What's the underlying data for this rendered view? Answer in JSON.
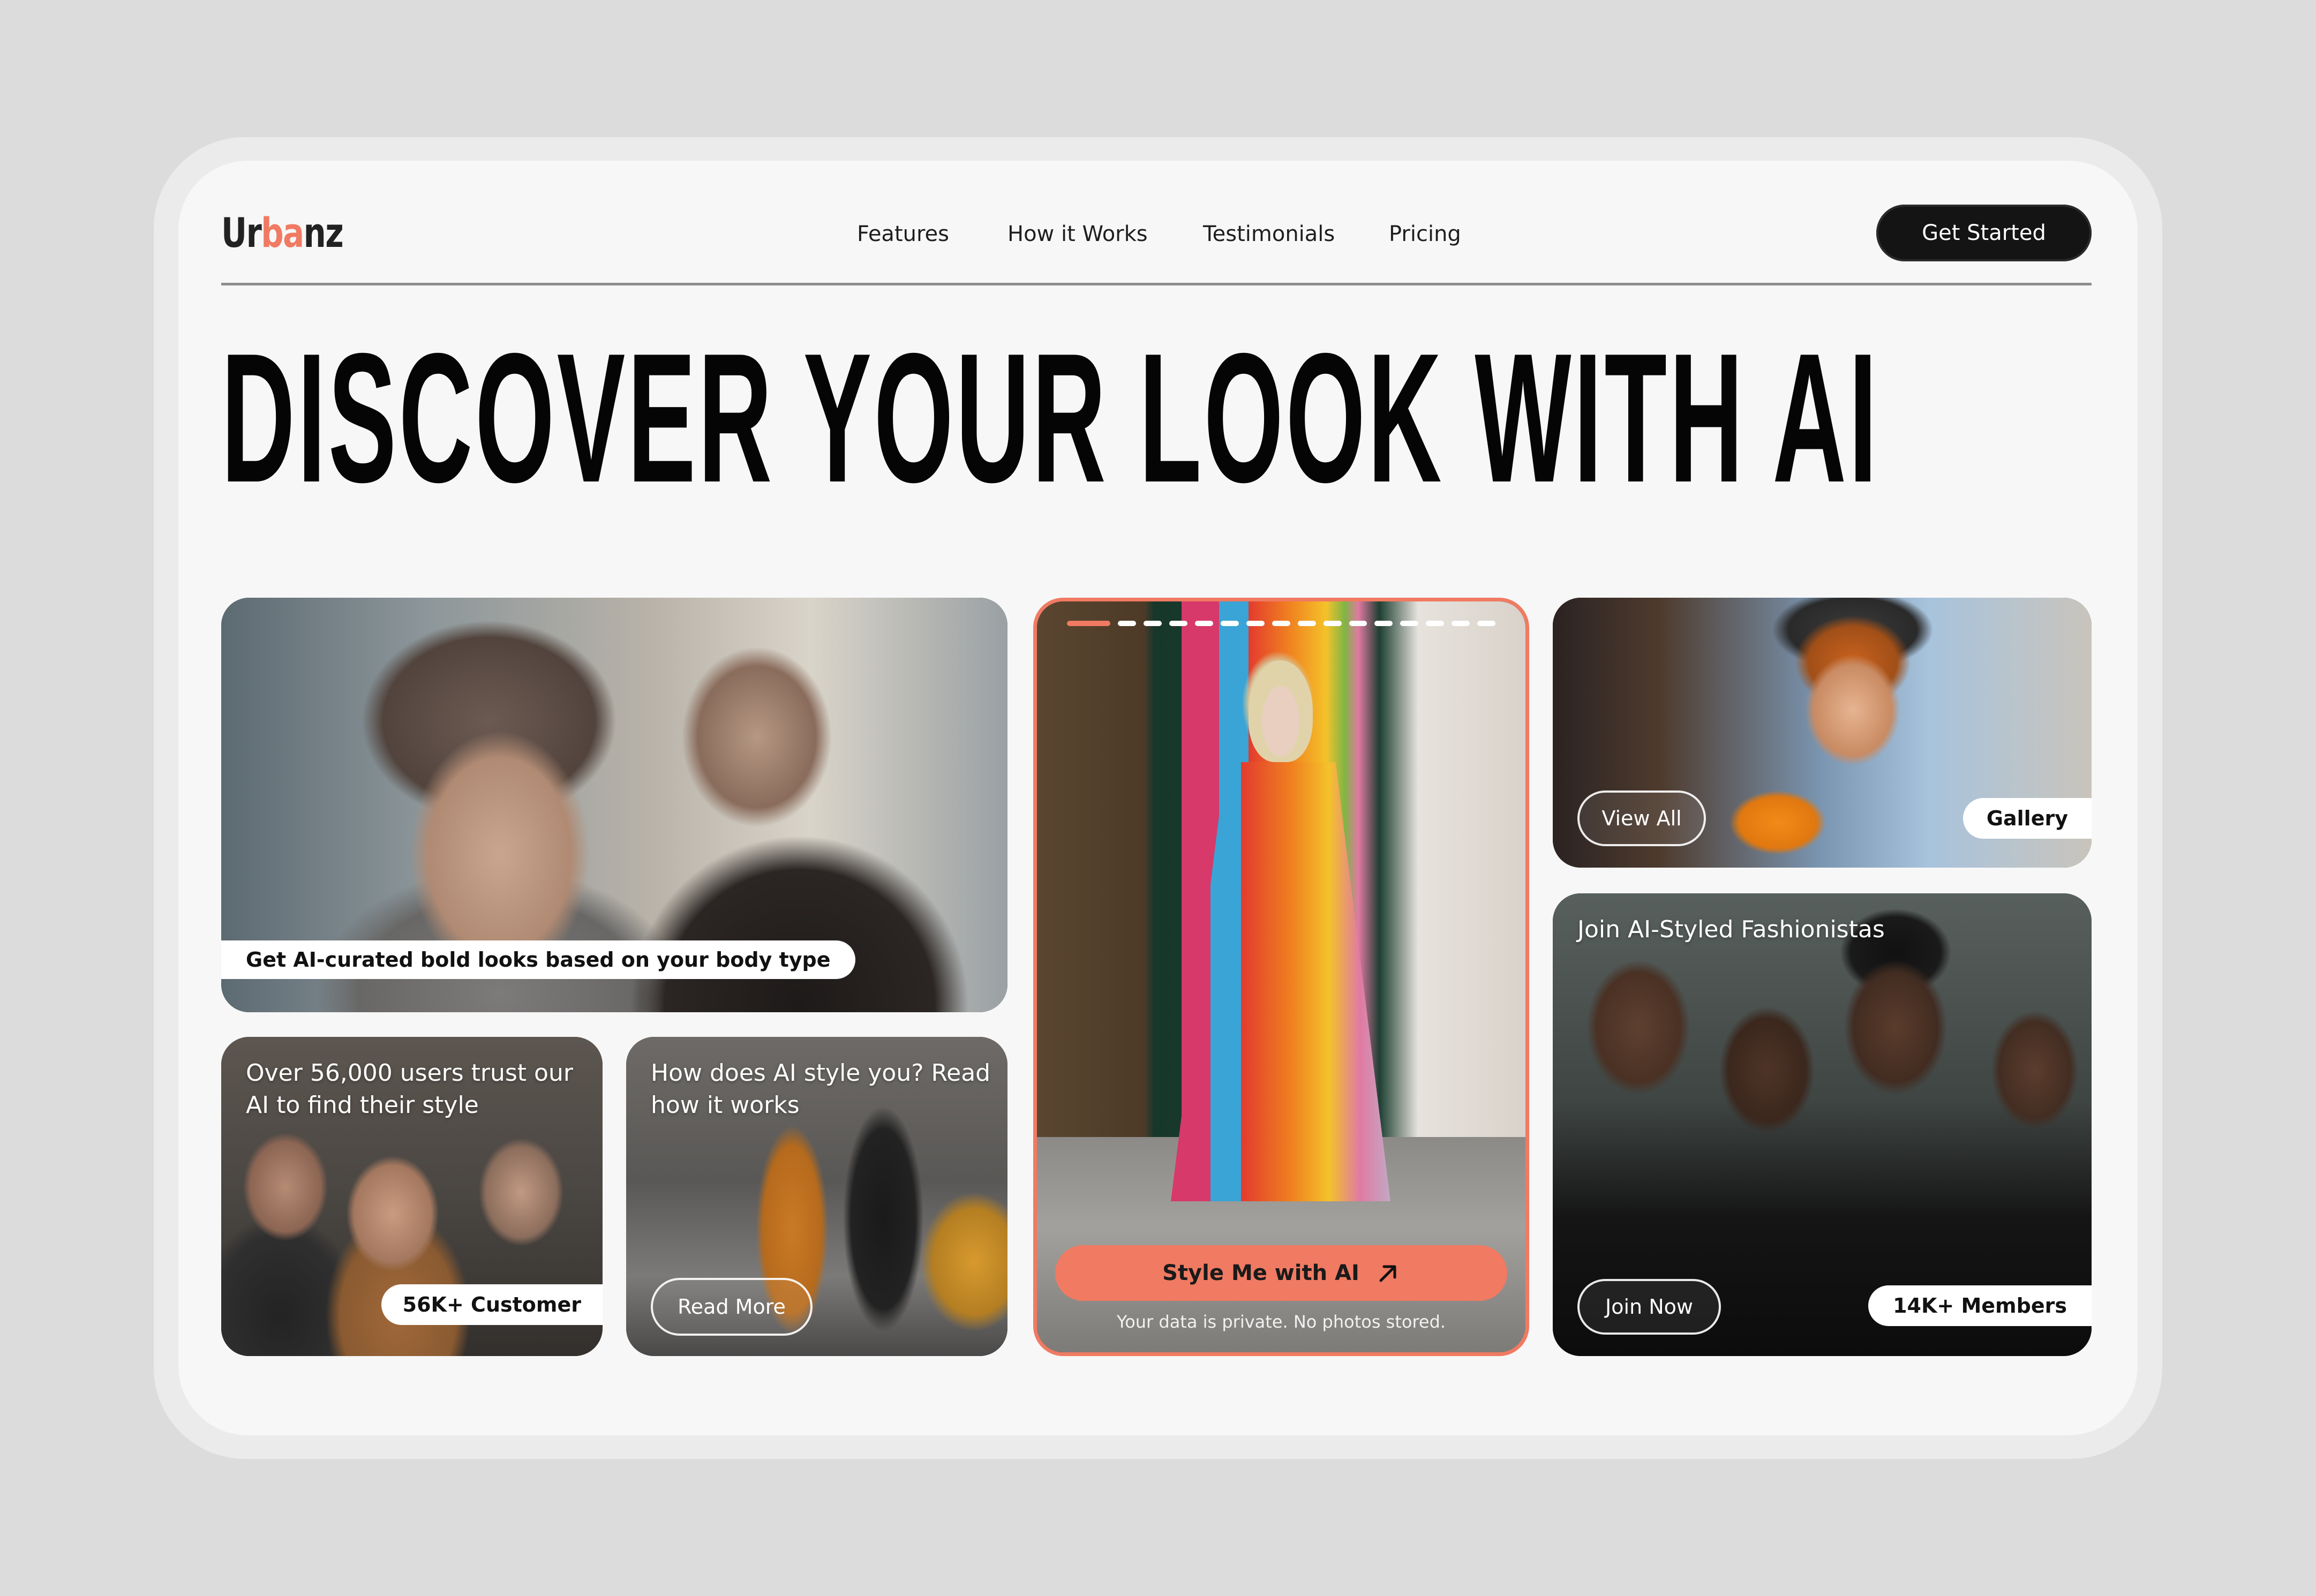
{
  "logo": {
    "part1": "Ur",
    "part2": "ba",
    "part3": "nz"
  },
  "nav": {
    "items": [
      "Features",
      "How it Works",
      "Testimonials",
      "Pricing"
    ],
    "cta": "Get Started"
  },
  "hero": {
    "headline": "DISCOVER YOUR LOOK WITH AI"
  },
  "cards": {
    "feature": {
      "caption": "Get AI-curated bold looks based on your body type"
    },
    "users": {
      "text": "Over 56,000 users trust our AI to find their style",
      "badge": "56K+  Customer"
    },
    "how": {
      "text": "How does AI style you? Read how it works",
      "button": "Read More"
    },
    "stylist": {
      "button": "Style Me with AI",
      "note": "Your data is private. No photos stored.",
      "progress_segments": 16,
      "progress_active": 1
    },
    "gallery": {
      "button": "View All",
      "badge": "Gallery"
    },
    "community": {
      "text": "Join AI-Styled Fashionistas",
      "button": "Join Now",
      "badge": "14K+ Members"
    }
  },
  "colors": {
    "accent": "#f07a62",
    "dark": "#141414",
    "background": "#f7f7f7"
  }
}
